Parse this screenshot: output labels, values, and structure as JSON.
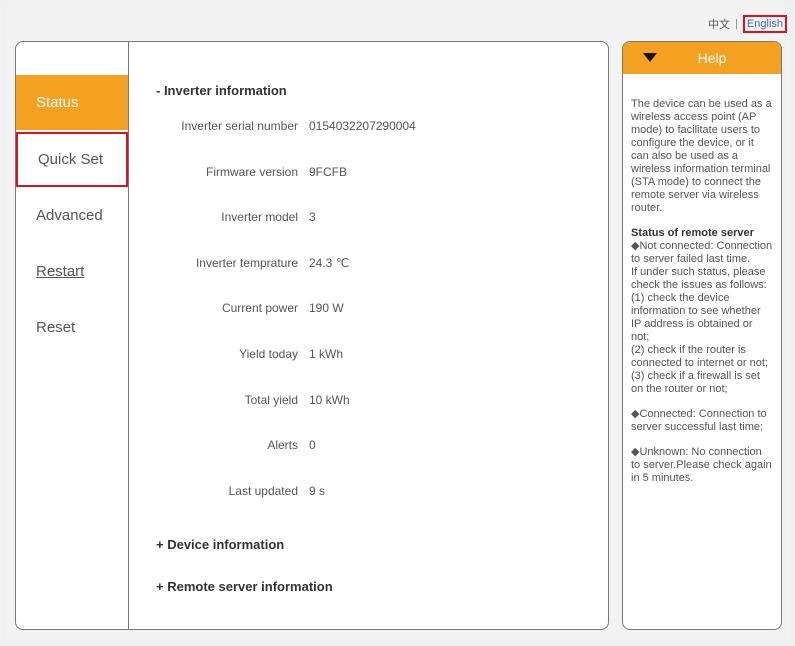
{
  "lang": {
    "chinese": "中文",
    "separator": "|",
    "english": "English"
  },
  "nav": {
    "items": [
      {
        "label": "Status"
      },
      {
        "label": "Quick Set"
      },
      {
        "label": "Advanced"
      },
      {
        "label": "Restart"
      },
      {
        "label": "Reset"
      }
    ]
  },
  "inverter": {
    "header": "-  Inverter information",
    "rows": [
      {
        "label": "Inverter serial number",
        "value": "0154032207290004"
      },
      {
        "label": "Firmware version",
        "value": "9FCFB"
      },
      {
        "label": "Inverter model",
        "value": "3"
      },
      {
        "label": "Inverter temprature",
        "value": "24.3 ℃"
      },
      {
        "label": "Current power",
        "value": "190 W"
      },
      {
        "label": "Yield today",
        "value": "1 kWh"
      },
      {
        "label": "Total yield",
        "value": "10 kWh"
      },
      {
        "label": "Alerts",
        "value": "0"
      },
      {
        "label": "Last updated",
        "value": "9 s"
      }
    ]
  },
  "device_header": "+  Device information",
  "remote_header": "+  Remote server information",
  "help": {
    "title": "Help",
    "intro": "The device can be used as a wireless access point (AP mode) to facilitate users to configure the device, or it can also be used as a wireless information terminal (STA mode) to connect the remote server via wireless router.",
    "status_title": "Status of remote server",
    "not_connected": "◆Not connected: Connection to server failed last time.",
    "check_intro": "If under such status, please check the issues as follows:",
    "check1": "(1) check the device information to see whether IP address is obtained or not;",
    "check2": "(2) check if the router is connected to internet or not;",
    "check3": "(3) check if a firewall is set on the router or not;",
    "connected": "◆Connected: Connection to server successful last time;",
    "unknown": "◆Unknown: No connection to server.Please check again in 5 minutes."
  },
  "colors": {
    "accent": "#f4a021",
    "highlight": "#d9141e",
    "link": "#3a6bbd"
  }
}
